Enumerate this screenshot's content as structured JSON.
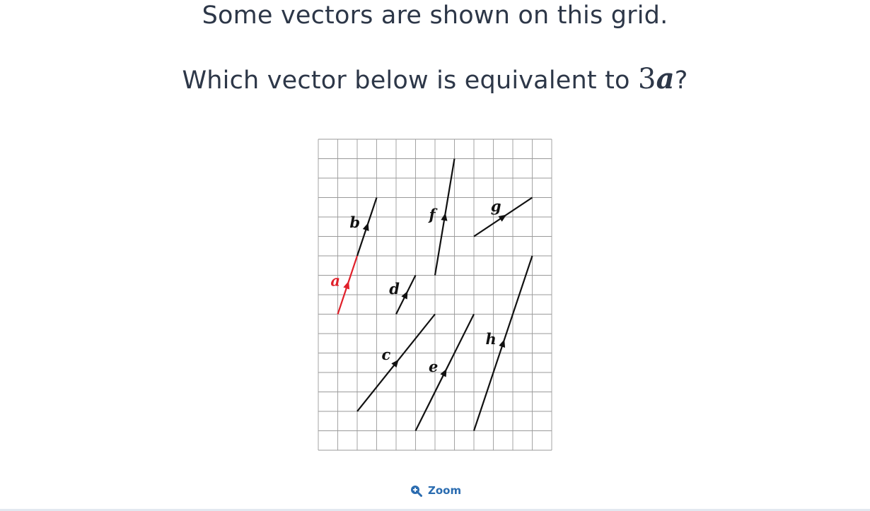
{
  "question": {
    "line1": "Some vectors are shown on this grid.",
    "line2_prefix": "Which vector below is equivalent to ",
    "line2_coeff": "3",
    "line2_vector": "a",
    "line2_suffix": "?"
  },
  "diagram": {
    "grid": {
      "cols": 12,
      "rows": 16
    },
    "highlight_color": "#e0202a",
    "vector_color": "#111111",
    "vectors": [
      {
        "label": "a",
        "from": [
          1,
          9
        ],
        "to": [
          2,
          6
        ],
        "highlight": true
      },
      {
        "label": "b",
        "from": [
          2,
          6
        ],
        "to": [
          3,
          3
        ],
        "highlight": false
      },
      {
        "label": "c",
        "from": [
          2,
          14
        ],
        "to": [
          6,
          9
        ],
        "highlight": false
      },
      {
        "label": "d",
        "from": [
          4,
          9
        ],
        "to": [
          5,
          7
        ],
        "highlight": false
      },
      {
        "label": "e",
        "from": [
          5,
          15
        ],
        "to": [
          8,
          9
        ],
        "highlight": false
      },
      {
        "label": "f",
        "from": [
          6,
          7
        ],
        "to": [
          7,
          1
        ],
        "highlight": false
      },
      {
        "label": "g",
        "from": [
          8,
          5
        ],
        "to": [
          11,
          3
        ],
        "highlight": false
      },
      {
        "label": "h",
        "from": [
          8,
          15
        ],
        "to": [
          11,
          6
        ],
        "highlight": false
      }
    ]
  },
  "zoom": {
    "label": "Zoom",
    "icon": "zoom-in-icon"
  }
}
